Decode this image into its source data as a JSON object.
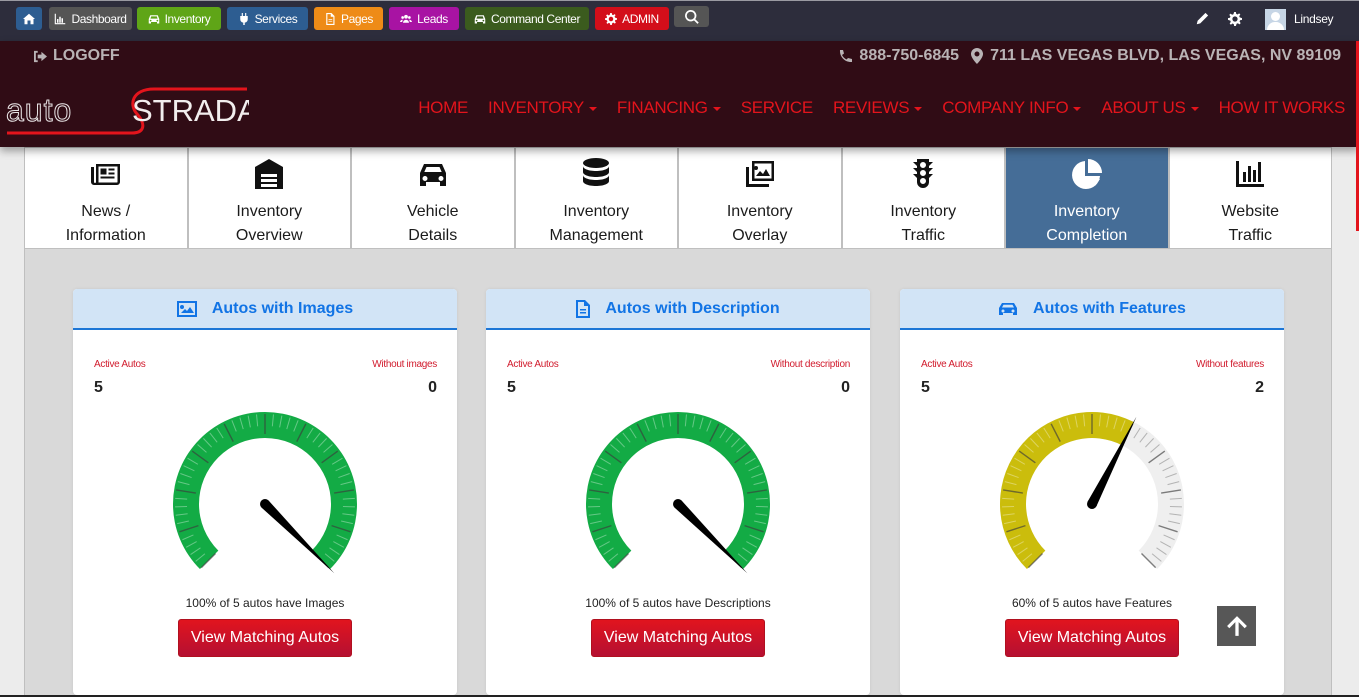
{
  "admin_bar": {
    "buttons": [
      {
        "id": "home",
        "label": "",
        "icon": "home-icon",
        "color": "#2d5d91"
      },
      {
        "id": "dashboard",
        "label": "Dashboard",
        "icon": "bar-chart-icon",
        "color": "#555555"
      },
      {
        "id": "inventory",
        "label": "Inventory",
        "icon": "car-icon",
        "color": "#5fa517"
      },
      {
        "id": "services",
        "label": "Services",
        "icon": "plug-icon",
        "color": "#2d5d91"
      },
      {
        "id": "pages",
        "label": "Pages",
        "icon": "file-icon",
        "color": "#ee8b17"
      },
      {
        "id": "leads",
        "label": "Leads",
        "icon": "users-icon",
        "color": "#a813a3"
      },
      {
        "id": "command_center",
        "label": "Command Center",
        "icon": "car-icon",
        "color": "#3b5b1e"
      },
      {
        "id": "admin",
        "label": "ADMIN",
        "icon": "gear-icon",
        "color": "#d30e1a"
      },
      {
        "id": "search",
        "label": "",
        "icon": "search-icon",
        "color": "#555555"
      }
    ],
    "user_name": "Lindsey"
  },
  "header": {
    "logoff_label": "LOGOFF",
    "phone": "888-750-6845",
    "address": "711 LAS VEGAS BLVD, LAS VEGAS, NV 89109",
    "logo_light": "auto",
    "logo_bold": "STRADA",
    "logo_accent": "#e3141c",
    "nav": [
      {
        "label": "HOME",
        "dropdown": false
      },
      {
        "label": "INVENTORY",
        "dropdown": true
      },
      {
        "label": "FINANCING",
        "dropdown": true
      },
      {
        "label": "SERVICE",
        "dropdown": false
      },
      {
        "label": "REVIEWS",
        "dropdown": true
      },
      {
        "label": "COMPANY INFO",
        "dropdown": true
      },
      {
        "label": "ABOUT US",
        "dropdown": true
      },
      {
        "label": "HOW IT WORKS",
        "dropdown": false
      }
    ]
  },
  "tabs": [
    {
      "line1": "News /",
      "line2": "Information",
      "icon": "newspaper-icon",
      "active": false
    },
    {
      "line1": "Inventory",
      "line2": "Overview",
      "icon": "warehouse-icon",
      "active": false
    },
    {
      "line1": "Vehicle",
      "line2": "Details",
      "icon": "car-icon",
      "active": false
    },
    {
      "line1": "Inventory",
      "line2": "Management",
      "icon": "database-icon",
      "active": false
    },
    {
      "line1": "Inventory",
      "line2": "Overlay",
      "icon": "images-icon",
      "active": false
    },
    {
      "line1": "Inventory",
      "line2": "Traffic",
      "icon": "traffic-light-icon",
      "active": false
    },
    {
      "line1": "Inventory",
      "line2": "Completion",
      "icon": "pie-chart-icon",
      "active": true
    },
    {
      "line1": "Website",
      "line2": "Traffic",
      "icon": "bar-chart-icon",
      "active": false
    }
  ],
  "cards": [
    {
      "title": "Autos with Images",
      "icon": "image-icon",
      "active_label": "Active Autos",
      "active_value": "5",
      "without_label": "Without images",
      "without_value": "0",
      "percent": 100,
      "gauge_color": "#13ab45",
      "caption": "100% of 5 autos have Images",
      "button_label": "View Matching Autos"
    },
    {
      "title": "Autos with Description",
      "icon": "document-icon",
      "active_label": "Active Autos",
      "active_value": "5",
      "without_label": "Without description",
      "without_value": "0",
      "percent": 100,
      "gauge_color": "#13ab45",
      "caption": "100% of 5 autos have Descriptions",
      "button_label": "View Matching Autos"
    },
    {
      "title": "Autos with Features",
      "icon": "car-icon",
      "active_label": "Active Autos",
      "active_value": "5",
      "without_label": "Without features",
      "without_value": "2",
      "percent": 60,
      "gauge_color": "#cbbd0c",
      "caption": "60% of 5 autos have Features",
      "button_label": "View Matching Autos"
    }
  ],
  "gauge_track_color": "#efefef",
  "scroll_top_icon": "arrow-up-icon"
}
